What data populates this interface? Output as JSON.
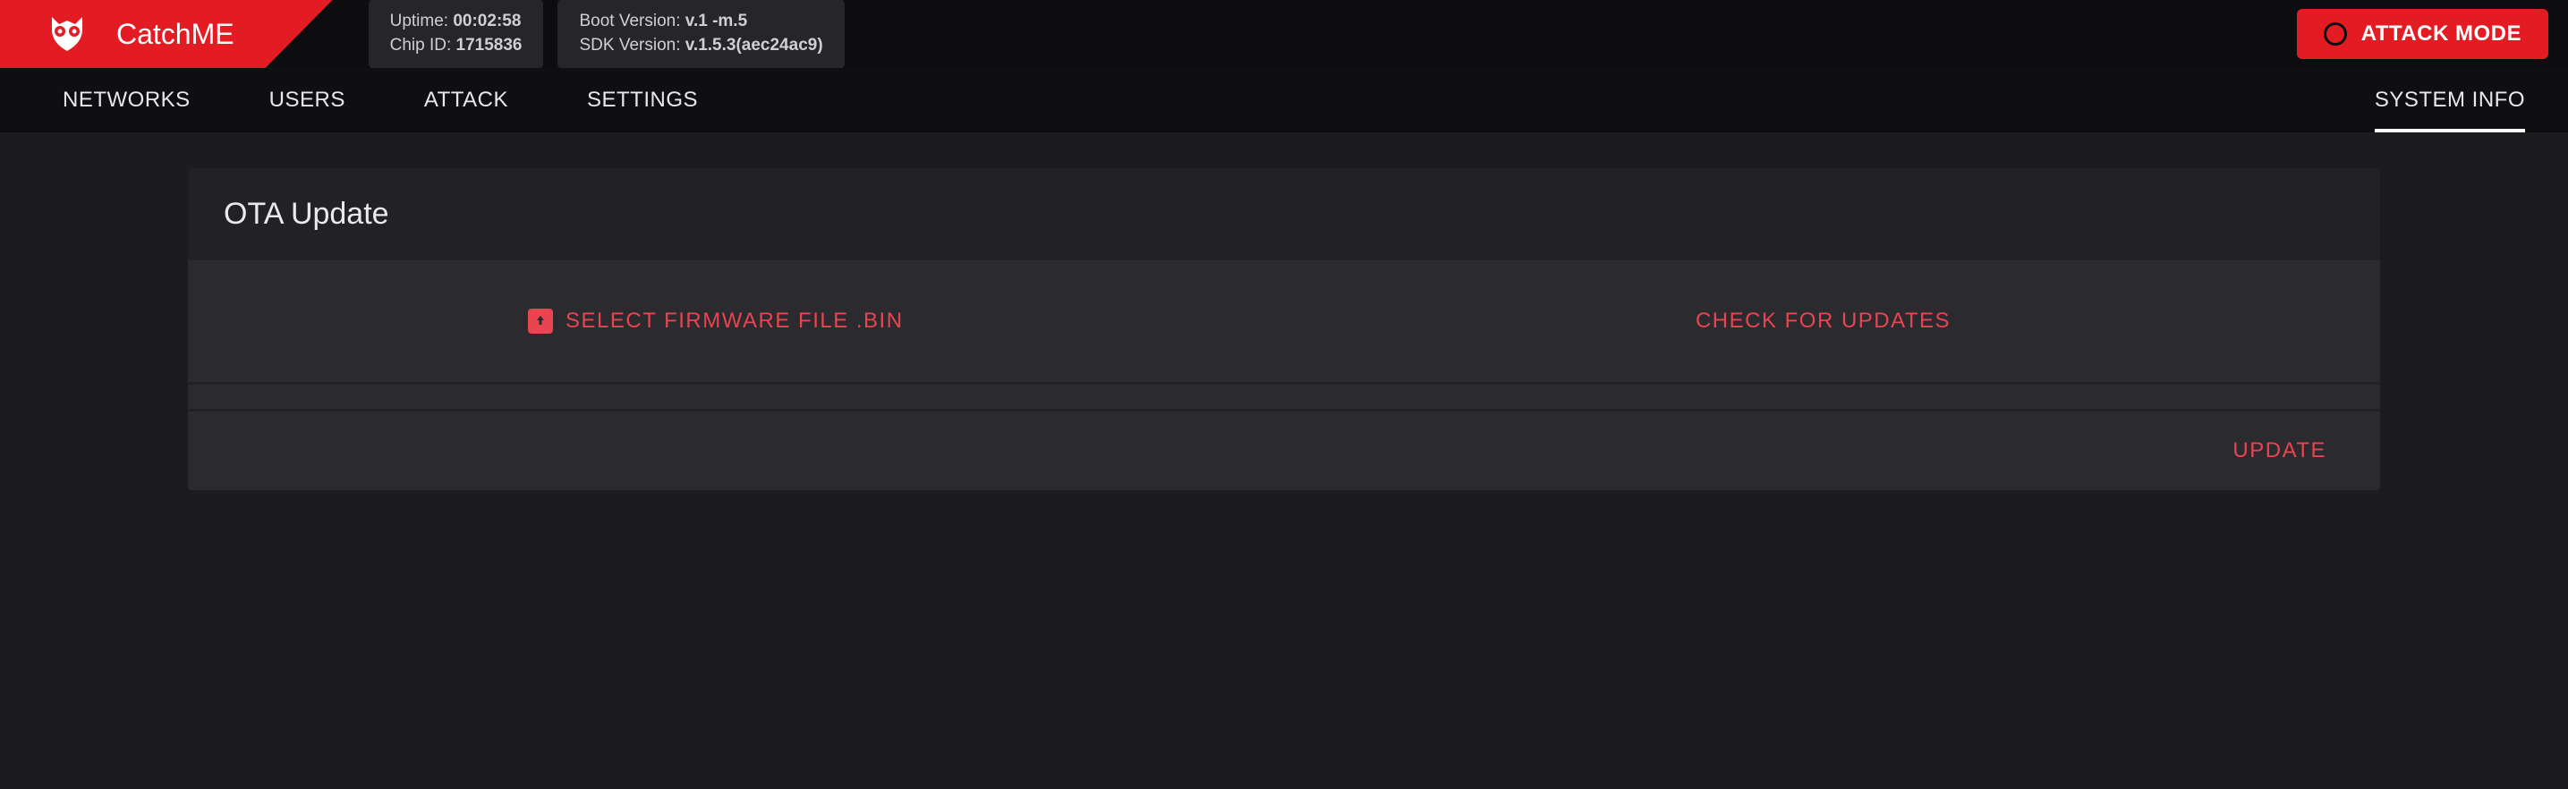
{
  "header": {
    "app_title": "CatchME",
    "info": {
      "uptime_label": "Uptime: ",
      "uptime_value": "00:02:58",
      "chip_id_label": "Chip ID: ",
      "chip_id_value": "1715836",
      "boot_version_label": "Boot Version: ",
      "boot_version_value": "v.1 -m.5",
      "sdk_version_label": "SDK Version: ",
      "sdk_version_value": "v.1.5.3(aec24ac9)"
    },
    "attack_mode_label": "ATTACK MODE"
  },
  "nav": {
    "items": [
      "NETWORKS",
      "USERS",
      "ATTACK",
      "SETTINGS",
      "SYSTEM INFO"
    ]
  },
  "card": {
    "title": "OTA Update",
    "select_firmware_label": "SELECT FIRMWARE FILE .BIN",
    "check_updates_label": "CHECK FOR UPDATES",
    "update_button_label": "UPDATE"
  }
}
